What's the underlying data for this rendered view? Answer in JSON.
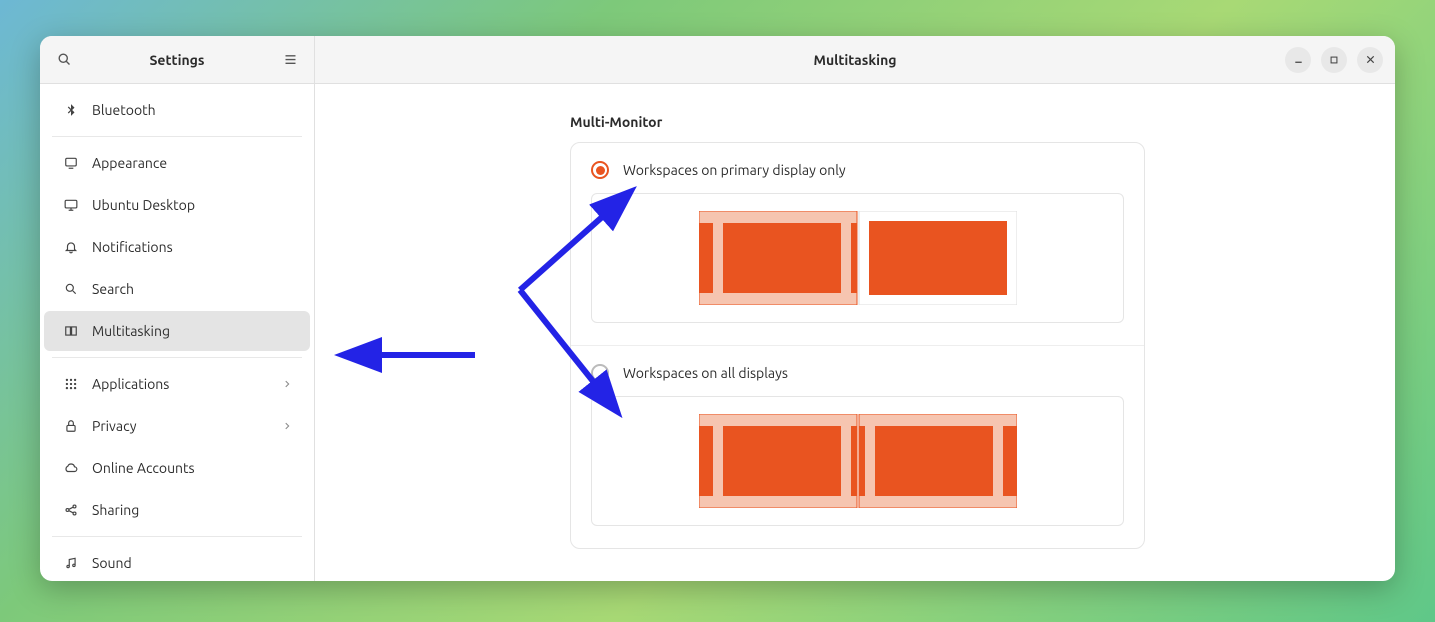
{
  "sidebar": {
    "title": "Settings",
    "items": [
      {
        "label": "Bluetooth",
        "icon": "bluetooth",
        "sep_after": true
      },
      {
        "label": "Appearance",
        "icon": "appearance"
      },
      {
        "label": "Ubuntu Desktop",
        "icon": "desktop"
      },
      {
        "label": "Notifications",
        "icon": "bell"
      },
      {
        "label": "Search",
        "icon": "search"
      },
      {
        "label": "Multitasking",
        "icon": "multitask",
        "active": true,
        "sep_after": true
      },
      {
        "label": "Applications",
        "icon": "apps",
        "has_chevron": true
      },
      {
        "label": "Privacy",
        "icon": "lock",
        "has_chevron": true
      },
      {
        "label": "Online Accounts",
        "icon": "cloud"
      },
      {
        "label": "Sharing",
        "icon": "share",
        "sep_after": true
      },
      {
        "label": "Sound",
        "icon": "sound"
      }
    ]
  },
  "header": {
    "title": "Multitasking"
  },
  "section": {
    "title": "Multi-Monitor",
    "options": [
      {
        "label": "Workspaces on primary display only",
        "selected": true
      },
      {
        "label": "Workspaces on all displays",
        "selected": false
      }
    ]
  },
  "annotations": {
    "arrow_color": "#2323e6"
  }
}
